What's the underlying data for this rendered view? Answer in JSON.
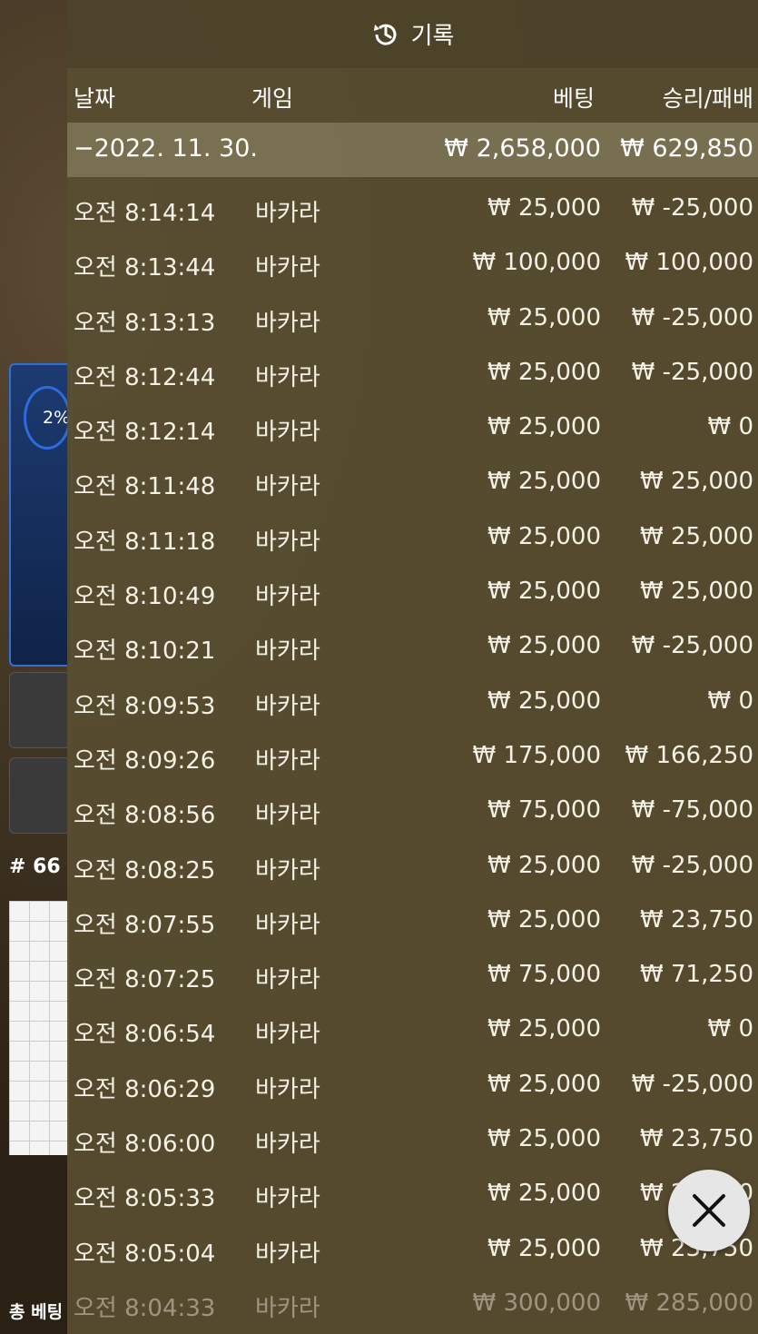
{
  "background": {
    "percent": "2%",
    "round_number": "# 66",
    "bottom_text": "총 베팅"
  },
  "panel": {
    "title": "기록",
    "icon": "history-icon",
    "columns": {
      "date": "날짜",
      "game": "게임",
      "bet": "베팅",
      "result": "승리/패배"
    },
    "summary": {
      "date": "−2022. 11. 30.",
      "bet": "₩ 2,658,000",
      "result": "₩ 629,850"
    },
    "rows": [
      {
        "time": "오전 8:14:14",
        "game": "바카라",
        "bet": "₩ 25,000",
        "result": "₩ -25,000"
      },
      {
        "time": "오전 8:13:44",
        "game": "바카라",
        "bet": "₩ 100,000",
        "result": "₩ 100,000"
      },
      {
        "time": "오전 8:13:13",
        "game": "바카라",
        "bet": "₩ 25,000",
        "result": "₩ -25,000"
      },
      {
        "time": "오전 8:12:44",
        "game": "바카라",
        "bet": "₩ 25,000",
        "result": "₩ -25,000"
      },
      {
        "time": "오전 8:12:14",
        "game": "바카라",
        "bet": "₩ 25,000",
        "result": "₩ 0"
      },
      {
        "time": "오전 8:11:48",
        "game": "바카라",
        "bet": "₩ 25,000",
        "result": "₩ 25,000"
      },
      {
        "time": "오전 8:11:18",
        "game": "바카라",
        "bet": "₩ 25,000",
        "result": "₩ 25,000"
      },
      {
        "time": "오전 8:10:49",
        "game": "바카라",
        "bet": "₩ 25,000",
        "result": "₩ 25,000"
      },
      {
        "time": "오전 8:10:21",
        "game": "바카라",
        "bet": "₩ 25,000",
        "result": "₩ -25,000"
      },
      {
        "time": "오전 8:09:53",
        "game": "바카라",
        "bet": "₩ 25,000",
        "result": "₩ 0"
      },
      {
        "time": "오전 8:09:26",
        "game": "바카라",
        "bet": "₩ 175,000",
        "result": "₩ 166,250"
      },
      {
        "time": "오전 8:08:56",
        "game": "바카라",
        "bet": "₩ 75,000",
        "result": "₩ -75,000"
      },
      {
        "time": "오전 8:08:25",
        "game": "바카라",
        "bet": "₩ 25,000",
        "result": "₩ -25,000"
      },
      {
        "time": "오전 8:07:55",
        "game": "바카라",
        "bet": "₩ 25,000",
        "result": "₩ 23,750"
      },
      {
        "time": "오전 8:07:25",
        "game": "바카라",
        "bet": "₩ 75,000",
        "result": "₩ 71,250"
      },
      {
        "time": "오전 8:06:54",
        "game": "바카라",
        "bet": "₩ 25,000",
        "result": "₩ 0"
      },
      {
        "time": "오전 8:06:29",
        "game": "바카라",
        "bet": "₩ 25,000",
        "result": "₩ -25,000"
      },
      {
        "time": "오전 8:06:00",
        "game": "바카라",
        "bet": "₩ 25,000",
        "result": "₩ 23,750"
      },
      {
        "time": "오전 8:05:33",
        "game": "바카라",
        "bet": "₩ 25,000",
        "result": "₩ 23,750"
      },
      {
        "time": "오전 8:05:04",
        "game": "바카라",
        "bet": "₩ 25,000",
        "result": "₩ 23,750"
      },
      {
        "time": "오전 8:04:33",
        "game": "바카라",
        "bet": "₩ 300,000",
        "result": "₩ 285,000"
      }
    ],
    "close_icon": "close-icon"
  }
}
